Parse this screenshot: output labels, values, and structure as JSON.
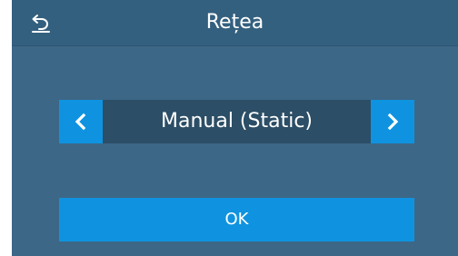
{
  "header": {
    "title": "Rețea",
    "back_icon": "back-arrow-icon"
  },
  "selector": {
    "value": "Manual (Static)",
    "prev_icon": "chevron-left-icon",
    "next_icon": "chevron-right-icon"
  },
  "actions": {
    "ok_label": "OK"
  },
  "colors": {
    "background": "#3c6786",
    "header": "#34607f",
    "accent": "#0f93e0",
    "selector_field": "#2c4e66",
    "text": "#ffffff"
  }
}
